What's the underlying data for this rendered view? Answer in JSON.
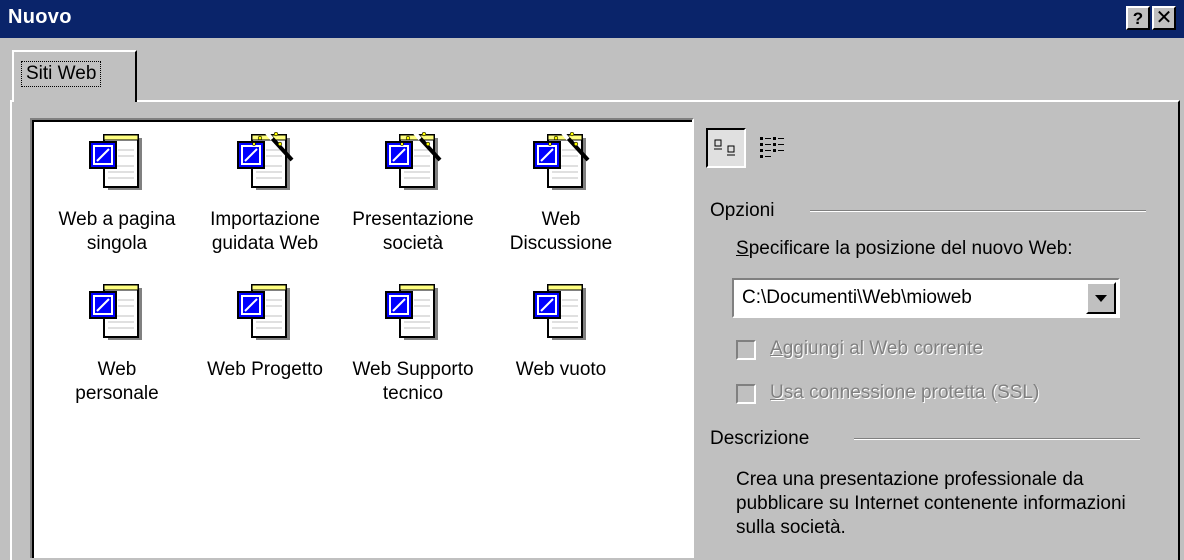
{
  "window": {
    "title": "Nuovo",
    "help_label": "?",
    "close_label": "✕"
  },
  "tabs": [
    {
      "label": "Siti Web"
    }
  ],
  "templates": [
    {
      "label": "Web a pagina\nsingola",
      "icon": "web-page-icon"
    },
    {
      "label": "Importazione\nguidata Web",
      "icon": "web-wizard-icon"
    },
    {
      "label": "Presentazione\nsocietà",
      "icon": "web-wizard-icon"
    },
    {
      "label": "Web\nDiscussione",
      "icon": "web-wizard-icon"
    },
    {
      "label": "Web\npersonale",
      "icon": "web-page-icon"
    },
    {
      "label": "Web Progetto",
      "icon": "web-page-icon"
    },
    {
      "label": "Web Supporto\ntecnico",
      "icon": "web-page-icon"
    },
    {
      "label": "Web vuoto",
      "icon": "web-page-icon"
    }
  ],
  "options": {
    "heading": "Opzioni",
    "location_label_first": "S",
    "location_label_rest": "pecificare la posizione del nuovo Web:",
    "location_value": "C:\\Documenti\\Web\\mioweb",
    "add_current_first": "A",
    "add_current_rest": "ggiungi al Web corrente",
    "add_current_checked": false,
    "ssl_first": "U",
    "ssl_rest": "sa connessione protetta (SSL)",
    "ssl_checked": false
  },
  "description": {
    "heading": "Descrizione",
    "text": "Crea una presentazione professionale da pubblicare su Internet contenente informazioni sulla società."
  },
  "colors": {
    "titlebar": "#0a246a",
    "face": "#c0c0c0",
    "icon_blue": "#0000ff"
  }
}
